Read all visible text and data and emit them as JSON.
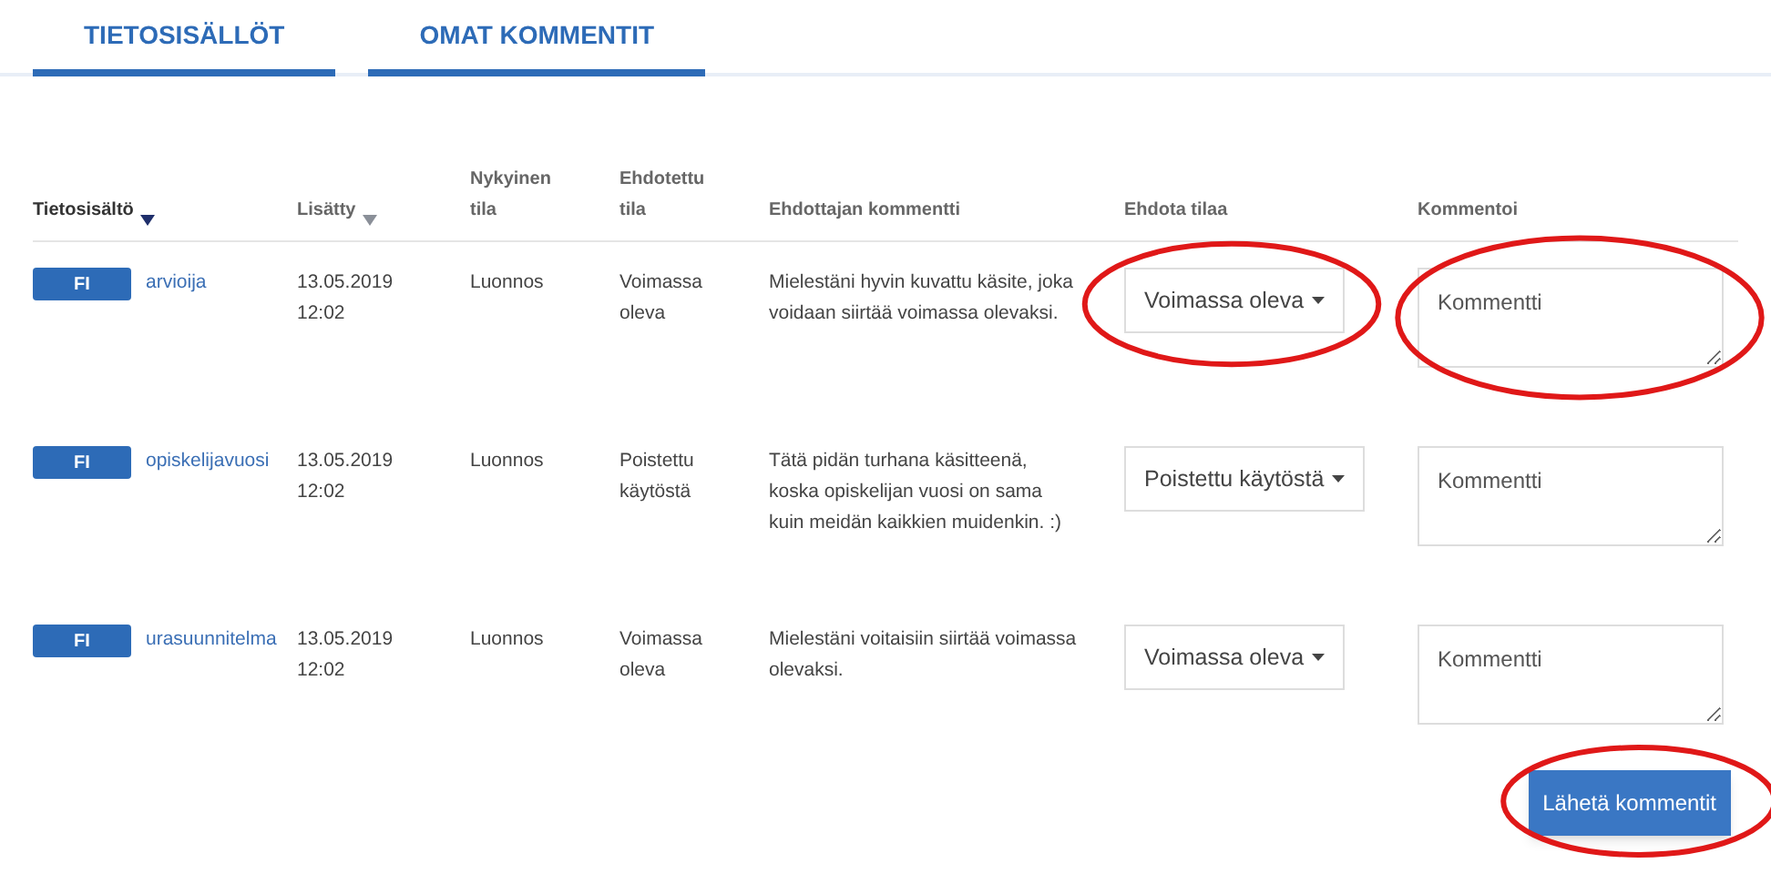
{
  "tabs": [
    {
      "label": "TIETOSISÄLLÖT",
      "selected": true
    },
    {
      "label": "OMAT KOMMENTIT",
      "selected": true
    }
  ],
  "table": {
    "columns": [
      {
        "label": "Tietosisältö",
        "sortable": true,
        "sorted": true
      },
      {
        "label": "Lisätty",
        "sortable": true,
        "sorted": false
      },
      {
        "label": "Nykyinen tila",
        "sortable": false,
        "sorted": false
      },
      {
        "label": "Ehdotettu tila",
        "sortable": false,
        "sorted": false
      },
      {
        "label": "Ehdottajan kommentti",
        "sortable": false,
        "sorted": false
      },
      {
        "label": "Ehdota tilaa",
        "sortable": false,
        "sorted": false
      },
      {
        "label": "Kommentoi",
        "sortable": false,
        "sorted": false
      }
    ],
    "rows": [
      {
        "language": "FI",
        "term": "arvioija",
        "added": "13.05.2019 12:02",
        "current_state": "Luonnos",
        "proposed_state": "Voimassa oleva",
        "proposer_comment": "Mielestäni hyvin kuvattu käsite, joka voidaan siirtää voimassa olevaksi.",
        "suggest": {
          "value": "Voimassa oleva",
          "highlighted": true
        },
        "comment": {
          "placeholder": "Kommentti",
          "highlighted": true
        }
      },
      {
        "language": "FI",
        "term": "opiskelijavuosi",
        "added": "13.05.2019 12:02",
        "current_state": "Luonnos",
        "proposed_state": "Poistettu käytöstä",
        "proposer_comment": "Tätä pidän turhana käsitteenä, koska opiskelijan vuosi on sama kuin meidän kaikkien muidenkin. :)",
        "suggest": {
          "value": "Poistettu käytöstä",
          "highlighted": false
        },
        "comment": {
          "placeholder": "Kommentti",
          "highlighted": false
        }
      },
      {
        "language": "FI",
        "term": "urasuunnitelma",
        "added": "13.05.2019 12:02",
        "current_state": "Luonnos",
        "proposed_state": "Voimassa oleva",
        "proposer_comment": "Mielestäni voitaisiin siirtää voimassa olevaksi.",
        "suggest": {
          "value": "Voimassa oleva",
          "highlighted": false
        },
        "comment": {
          "placeholder": "Kommentti",
          "highlighted": false
        }
      }
    ]
  },
  "submit": {
    "label": "Lähetä kommentit",
    "highlighted": true
  }
}
